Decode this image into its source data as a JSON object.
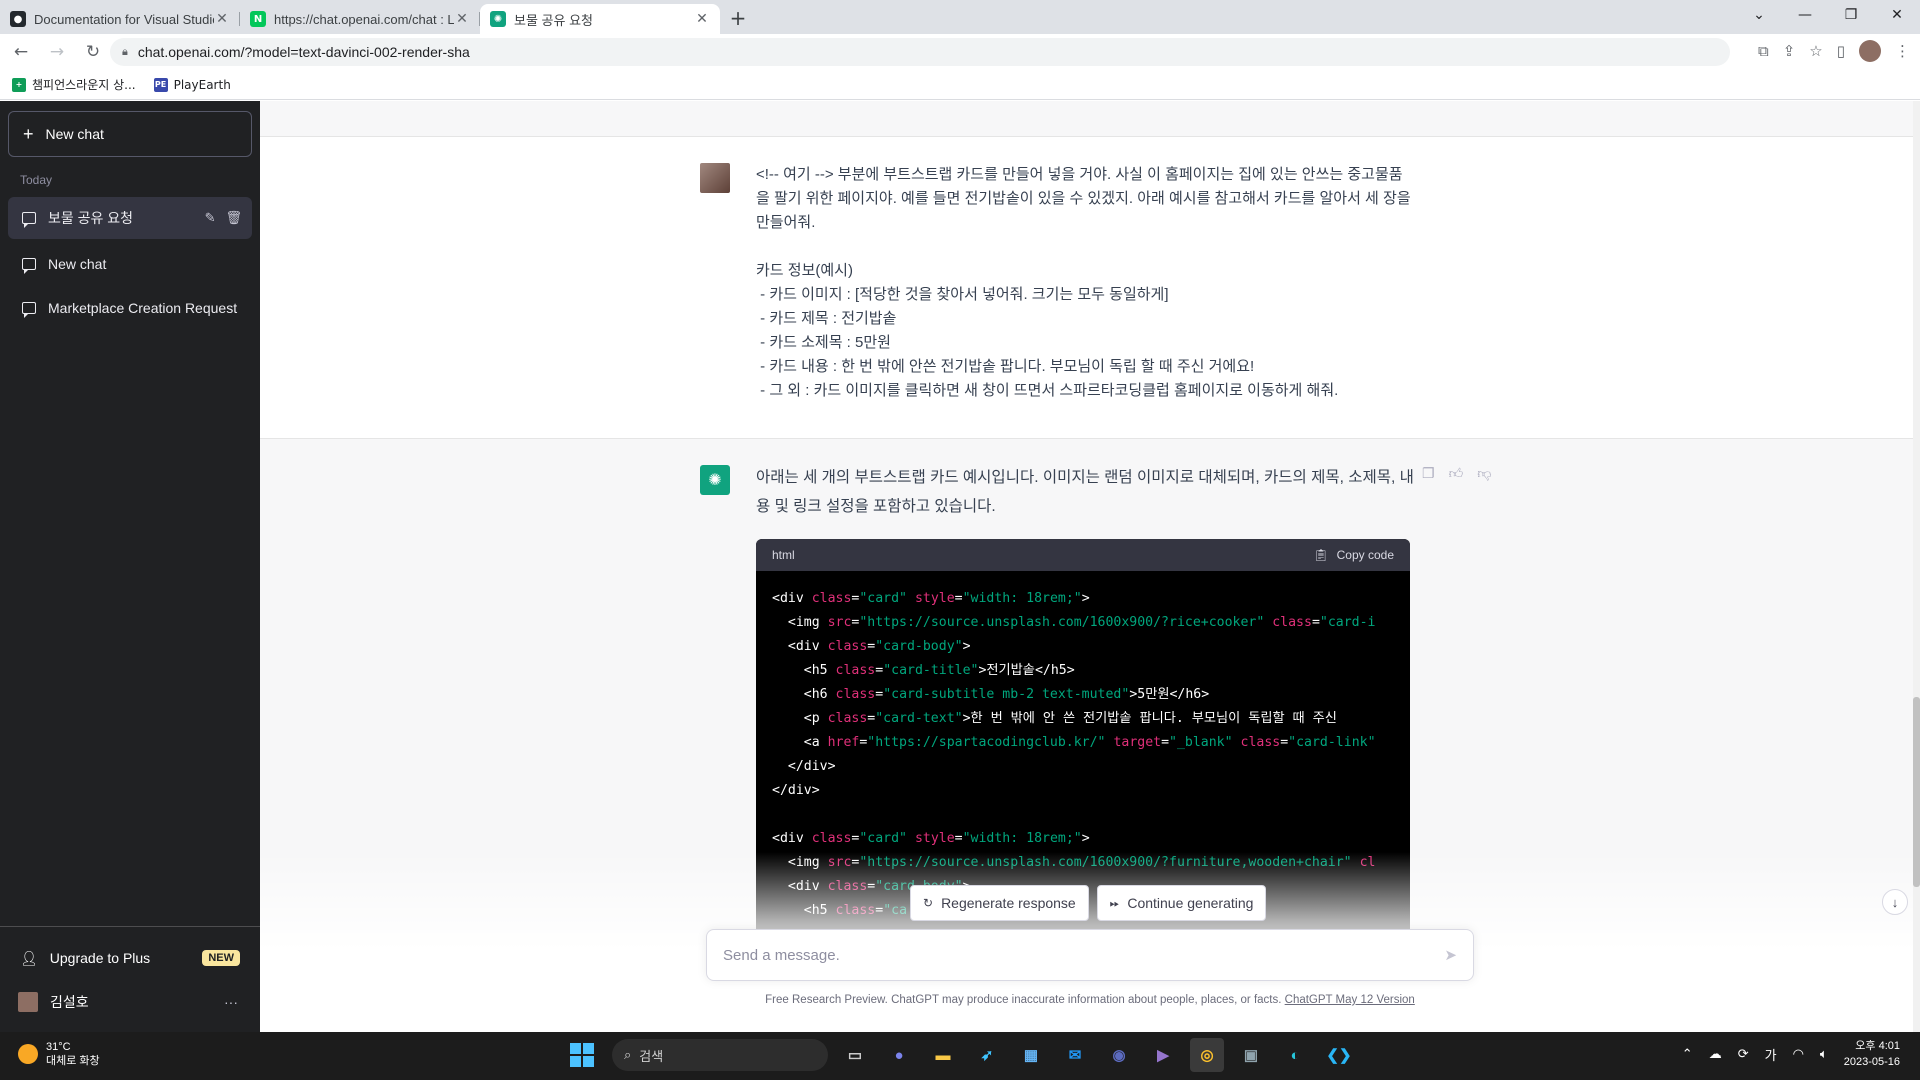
{
  "browser": {
    "tabs": [
      {
        "title": "Documentation for Visual Studio",
        "favicon": "github-icon",
        "color": "#24292e",
        "active": false
      },
      {
        "title": "https://chat.openai.com/chat : L",
        "favicon": "naver-icon",
        "color": "#03c75a",
        "active": false
      },
      {
        "title": "보물 공유 요청",
        "favicon": "chatgpt-icon",
        "color": "#10a37f",
        "active": true
      }
    ],
    "url": "chat.openai.com/?model=text-davinci-002-render-sha",
    "bookmarks": [
      {
        "label": "챔피언스라운지 상...",
        "icon": "sheets-icon",
        "color": "#0f9d58"
      },
      {
        "label": "PlayEarth",
        "icon": "playearth-icon",
        "color": "#3949ab"
      }
    ]
  },
  "sidebar": {
    "new_chat": "New chat",
    "section": "Today",
    "history": [
      {
        "label": "보물 공유 요청",
        "active": true
      },
      {
        "label": "New chat",
        "active": false
      },
      {
        "label": "Marketplace Creation Request",
        "active": false
      }
    ],
    "upgrade": "Upgrade to Plus",
    "badge": "NEW",
    "user": "김설호"
  },
  "conversation": {
    "user_message": [
      "<!-- 여기 --> 부분에 부트스트랩 카드를 만들어 넣을 거야. 사실 이 홈페이지는 집에 있는 안쓰는 중고물품을 팔기 위한 페이지야. 예를 들면 전기밥솥이 있을 수 있겠지. 아래 예시를 참고해서 카드를 알아서 세 장을 만들어줘.",
      "",
      "카드 정보(예시)",
      " - 카드 이미지 : [적당한 것을 찾아서 넣어줘. 크기는 모두 동일하게]",
      " - 카드 제목 : 전기밥솥",
      " - 카드 소제목 : 5만원",
      " - 카드 내용 : 한 번 밖에 안쓴 전기밥솥 팝니다. 부모님이 독립 할 때 주신 거에요!",
      " - 그 외 : 카드 이미지를 클릭하면 새 창이 뜨면서 스파르타코딩클럽 홈페이지로 이동하게 해줘."
    ],
    "assistant_intro": "아래는 세 개의 부트스트랩 카드 예시입니다. 이미지는 랜덤 이미지로 대체되며, 카드의 제목, 소제목, 내용 및 링크 설정을 포함하고 있습니다.",
    "code_lang": "html",
    "copy_label": "Copy code",
    "code_lines": [
      [
        [
          "t",
          "<div "
        ],
        [
          "a",
          "class"
        ],
        [
          "t",
          "="
        ],
        [
          "s",
          "\"card\""
        ],
        [
          "t",
          " "
        ],
        [
          "a",
          "style"
        ],
        [
          "t",
          "="
        ],
        [
          "s",
          "\"width: 18rem;\""
        ],
        [
          "t",
          ">"
        ]
      ],
      [
        [
          "t",
          "  <img "
        ],
        [
          "a",
          "src"
        ],
        [
          "t",
          "="
        ],
        [
          "s",
          "\"https://source.unsplash.com/1600x900/?rice+cooker\""
        ],
        [
          "t",
          " "
        ],
        [
          "a",
          "class"
        ],
        [
          "t",
          "="
        ],
        [
          "s",
          "\"card-i"
        ]
      ],
      [
        [
          "t",
          "  <div "
        ],
        [
          "a",
          "class"
        ],
        [
          "t",
          "="
        ],
        [
          "s",
          "\"card-body\""
        ],
        [
          "t",
          ">"
        ]
      ],
      [
        [
          "t",
          "    <h5 "
        ],
        [
          "a",
          "class"
        ],
        [
          "t",
          "="
        ],
        [
          "s",
          "\"card-title\""
        ],
        [
          "t",
          ">전기밥솥</h5>"
        ]
      ],
      [
        [
          "t",
          "    <h6 "
        ],
        [
          "a",
          "class"
        ],
        [
          "t",
          "="
        ],
        [
          "s",
          "\"card-subtitle mb-2 text-muted\""
        ],
        [
          "t",
          ">5만원</h6>"
        ]
      ],
      [
        [
          "t",
          "    <p "
        ],
        [
          "a",
          "class"
        ],
        [
          "t",
          "="
        ],
        [
          "s",
          "\"card-text\""
        ],
        [
          "t",
          ">한 번 밖에 안 쓴 전기밥솥 팝니다. 부모님이 독립할 때 주신 "
        ]
      ],
      [
        [
          "t",
          "    <a "
        ],
        [
          "a",
          "href"
        ],
        [
          "t",
          "="
        ],
        [
          "s",
          "\"https://spartacodingclub.kr/\""
        ],
        [
          "t",
          " "
        ],
        [
          "a",
          "target"
        ],
        [
          "t",
          "="
        ],
        [
          "s",
          "\"_blank\""
        ],
        [
          "t",
          " "
        ],
        [
          "a",
          "class"
        ],
        [
          "t",
          "="
        ],
        [
          "s",
          "\"card-link\""
        ]
      ],
      [
        [
          "t",
          "  </div>"
        ]
      ],
      [
        [
          "t",
          "</div>"
        ]
      ],
      [
        [
          "t",
          ""
        ]
      ],
      [
        [
          "t",
          "<div "
        ],
        [
          "a",
          "class"
        ],
        [
          "t",
          "="
        ],
        [
          "s",
          "\"card\""
        ],
        [
          "t",
          " "
        ],
        [
          "a",
          "style"
        ],
        [
          "t",
          "="
        ],
        [
          "s",
          "\"width: 18rem;\""
        ],
        [
          "t",
          ">"
        ]
      ],
      [
        [
          "t",
          "  <img "
        ],
        [
          "a",
          "src"
        ],
        [
          "t",
          "="
        ],
        [
          "s",
          "\"https://source.unsplash.com/1600x900/?furniture,wooden+chair\""
        ],
        [
          "t",
          " "
        ],
        [
          "a",
          "cl"
        ]
      ],
      [
        [
          "t",
          "  <div "
        ],
        [
          "a",
          "class"
        ],
        [
          "t",
          "="
        ],
        [
          "s",
          "\"card-body\""
        ],
        [
          "t",
          ">"
        ]
      ],
      [
        [
          "t",
          "    <h5 "
        ],
        [
          "a",
          "class"
        ],
        [
          "t",
          "="
        ],
        [
          "s",
          "\"ca"
        ]
      ]
    ],
    "regenerate": "Regenerate response",
    "continue": "Continue generating",
    "placeholder": "Send a message.",
    "disclaimer": "Free Research Preview. ChatGPT may produce inaccurate information about people, places, or facts.",
    "version_link": "ChatGPT May 12 Version"
  },
  "taskbar": {
    "temp": "31°C",
    "weather": "대체로 화창",
    "search": "검색",
    "ime": "가",
    "time": "오후 4:01",
    "date": "2023-05-16"
  }
}
